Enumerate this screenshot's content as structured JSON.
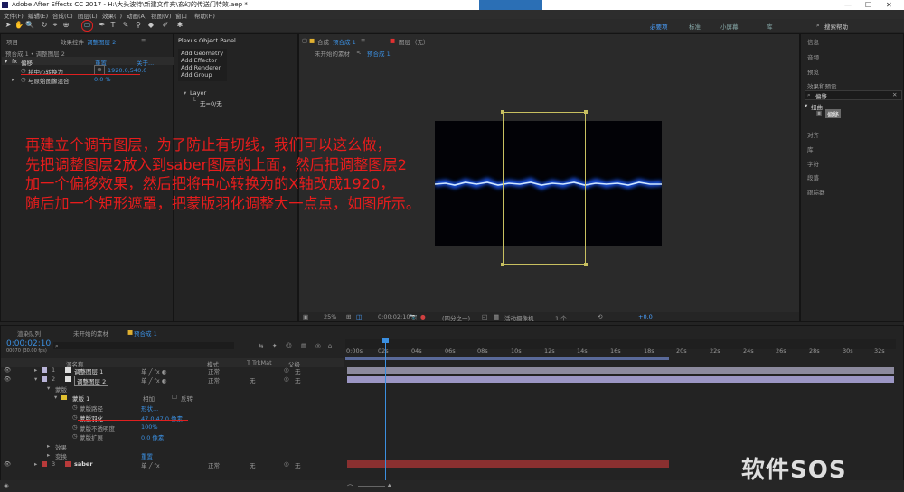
{
  "window": {
    "title": "Adobe After Effects CC 2017 - H:\\大头波特\\新建文件夹\\玄幻的传送门特效.aep *",
    "controls": [
      "—",
      "☐",
      "✕"
    ]
  },
  "menu": [
    "文件(F)",
    "编辑(E)",
    "合成(C)",
    "图层(L)",
    "效果(T)",
    "动画(A)",
    "视图(V)",
    "窗口",
    "帮助(H)"
  ],
  "toolbar": {
    "workspaces": [
      "必要项",
      "标准",
      "小屏幕",
      "库"
    ],
    "search_placeholder": "搜索帮助"
  },
  "effect_controls": {
    "tabs": [
      "项目",
      "效果控件",
      "调整图层 2"
    ],
    "breadcrumb": "预合成 1 • 调整图层 2",
    "effect_name": "偏移",
    "reset": "重置",
    "about": "关于...",
    "props": [
      {
        "label": "将中心转换为",
        "value": "1920.0,540.0"
      },
      {
        "label": "与原始图像混合",
        "value": "0.0 %"
      }
    ]
  },
  "plexus": {
    "title": "Plexus Object Panel",
    "items": [
      "Add Geometry",
      "Add Effector",
      "Add Renderer",
      "Add Group"
    ],
    "layer_title": "Layer",
    "layer_child": "无=0/无"
  },
  "comp_viewer": {
    "tabs": [
      "合成",
      "预合成 1",
      "图层",
      "（无）"
    ],
    "sub_tab": "未开始的素材",
    "sub_tab2": "预合成 1",
    "zoom": "25%",
    "timecode": "0:00:02:10",
    "resolution": "(四分之一)",
    "camera": "活动摄像机",
    "views": "1 个...",
    "exposure": "+0.0"
  },
  "right_panel": {
    "items": [
      "信息",
      "音频",
      "预览",
      "效果和预设"
    ],
    "search_value": "偏移",
    "tree_group": "扭曲",
    "tree_item": "偏移",
    "items2": [
      "对齐",
      "库",
      "字符",
      "段落",
      "跟踪器"
    ]
  },
  "overlay": {
    "lines": [
      "再建立个调节图层，为了防止有切线，我们可以这么做，",
      "先把调整图层2放入到saber图层的上面，然后把调整图层2",
      "加一个偏移效果，然后把将中心转换为的X轴改成1920，",
      "随后加一个矩形遮罩，把蒙版羽化调整大一点点，如图所示。"
    ]
  },
  "timeline": {
    "tabs": [
      "渲染队列",
      "未开始的素材",
      "预合成 1"
    ],
    "timecode": "0:00:02:10",
    "timecode_sub": "00070 (30.00 fps)",
    "columns": {
      "name": "源名称",
      "mode": "模式",
      "trkmat": "T TrkMat",
      "parent": "父级"
    },
    "ticks": [
      "0:00s",
      "02s",
      "04s",
      "06s",
      "08s",
      "10s",
      "12s",
      "14s",
      "16s",
      "18s",
      "20s",
      "22s",
      "24s",
      "26s",
      "28s",
      "30s",
      "32s"
    ],
    "layers": [
      {
        "num": "1",
        "name": "调整图层 1",
        "mode": "正常",
        "parent": "无",
        "color": "#b9b4d8"
      },
      {
        "num": "2",
        "name": "调整图层 2",
        "mode": "正常",
        "trk": "无",
        "parent": "无",
        "color": "#b9b4d8"
      },
      {
        "num": "3",
        "name": "saber",
        "mode": "正常",
        "trk": "无",
        "parent": "无",
        "color": "#b83a3a"
      }
    ],
    "mask_group": "蒙版",
    "mask_name": "蒙版 1",
    "mask_mode": "相加",
    "mask_invert": "反转",
    "mask_props": [
      {
        "label": "蒙版路径",
        "value": "形状..."
      },
      {
        "label": "蒙版羽化",
        "value": "47.0,47.0 像素"
      },
      {
        "label": "蒙版不透明度",
        "value": "100%"
      },
      {
        "label": "蒙版扩展",
        "value": "0.0 像素"
      }
    ],
    "effects_label": "效果",
    "transform_label": "变换",
    "transform_reset": "重置"
  },
  "watermark": "软件SOS",
  "colors": {
    "accent": "#3b8fe0",
    "annotation": "#e81c1c",
    "saber": "#2f7cff"
  }
}
